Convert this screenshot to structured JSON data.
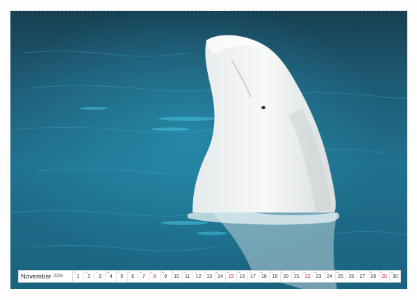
{
  "calendar": {
    "month": "November",
    "year": "2026",
    "days": [
      {
        "n": "1",
        "wd": "Su",
        "red": false
      },
      {
        "n": "2",
        "wd": "Mo",
        "red": false
      },
      {
        "n": "3",
        "wd": "Tu",
        "red": false
      },
      {
        "n": "4",
        "wd": "We",
        "red": false
      },
      {
        "n": "5",
        "wd": "Th",
        "red": false
      },
      {
        "n": "6",
        "wd": "Fr",
        "red": false
      },
      {
        "n": "7",
        "wd": "Sa",
        "red": false
      },
      {
        "n": "8",
        "wd": "Su",
        "red": true
      },
      {
        "n": "9",
        "wd": "Mo",
        "red": false
      },
      {
        "n": "10",
        "wd": "Tu",
        "red": false
      },
      {
        "n": "11",
        "wd": "We",
        "red": false
      },
      {
        "n": "12",
        "wd": "Th",
        "red": false
      },
      {
        "n": "13",
        "wd": "Fr",
        "red": false
      },
      {
        "n": "14",
        "wd": "Sa",
        "red": false
      },
      {
        "n": "15",
        "wd": "Su",
        "red": true
      },
      {
        "n": "16",
        "wd": "Mo",
        "red": false
      },
      {
        "n": "17",
        "wd": "Tu",
        "red": false
      },
      {
        "n": "18",
        "wd": "We",
        "red": false
      },
      {
        "n": "19",
        "wd": "Th",
        "red": false
      },
      {
        "n": "20",
        "wd": "Fr",
        "red": false
      },
      {
        "n": "21",
        "wd": "Sa",
        "red": false
      },
      {
        "n": "22",
        "wd": "Su",
        "red": true
      },
      {
        "n": "23",
        "wd": "Mo",
        "red": false
      },
      {
        "n": "24",
        "wd": "Tu",
        "red": false
      },
      {
        "n": "25",
        "wd": "We",
        "red": false
      },
      {
        "n": "26",
        "wd": "Th",
        "red": false
      },
      {
        "n": "27",
        "wd": "Fr",
        "red": false
      },
      {
        "n": "28",
        "wd": "Sa",
        "red": false
      },
      {
        "n": "29",
        "wd": "Su",
        "red": true
      },
      {
        "n": "30",
        "wd": "Mo",
        "red": false
      }
    ]
  },
  "colors": {
    "water_dark": "#1d4e63",
    "water_light": "#2aa6c2",
    "whale": "#f1f3f3",
    "sunday": "#c8102e"
  }
}
